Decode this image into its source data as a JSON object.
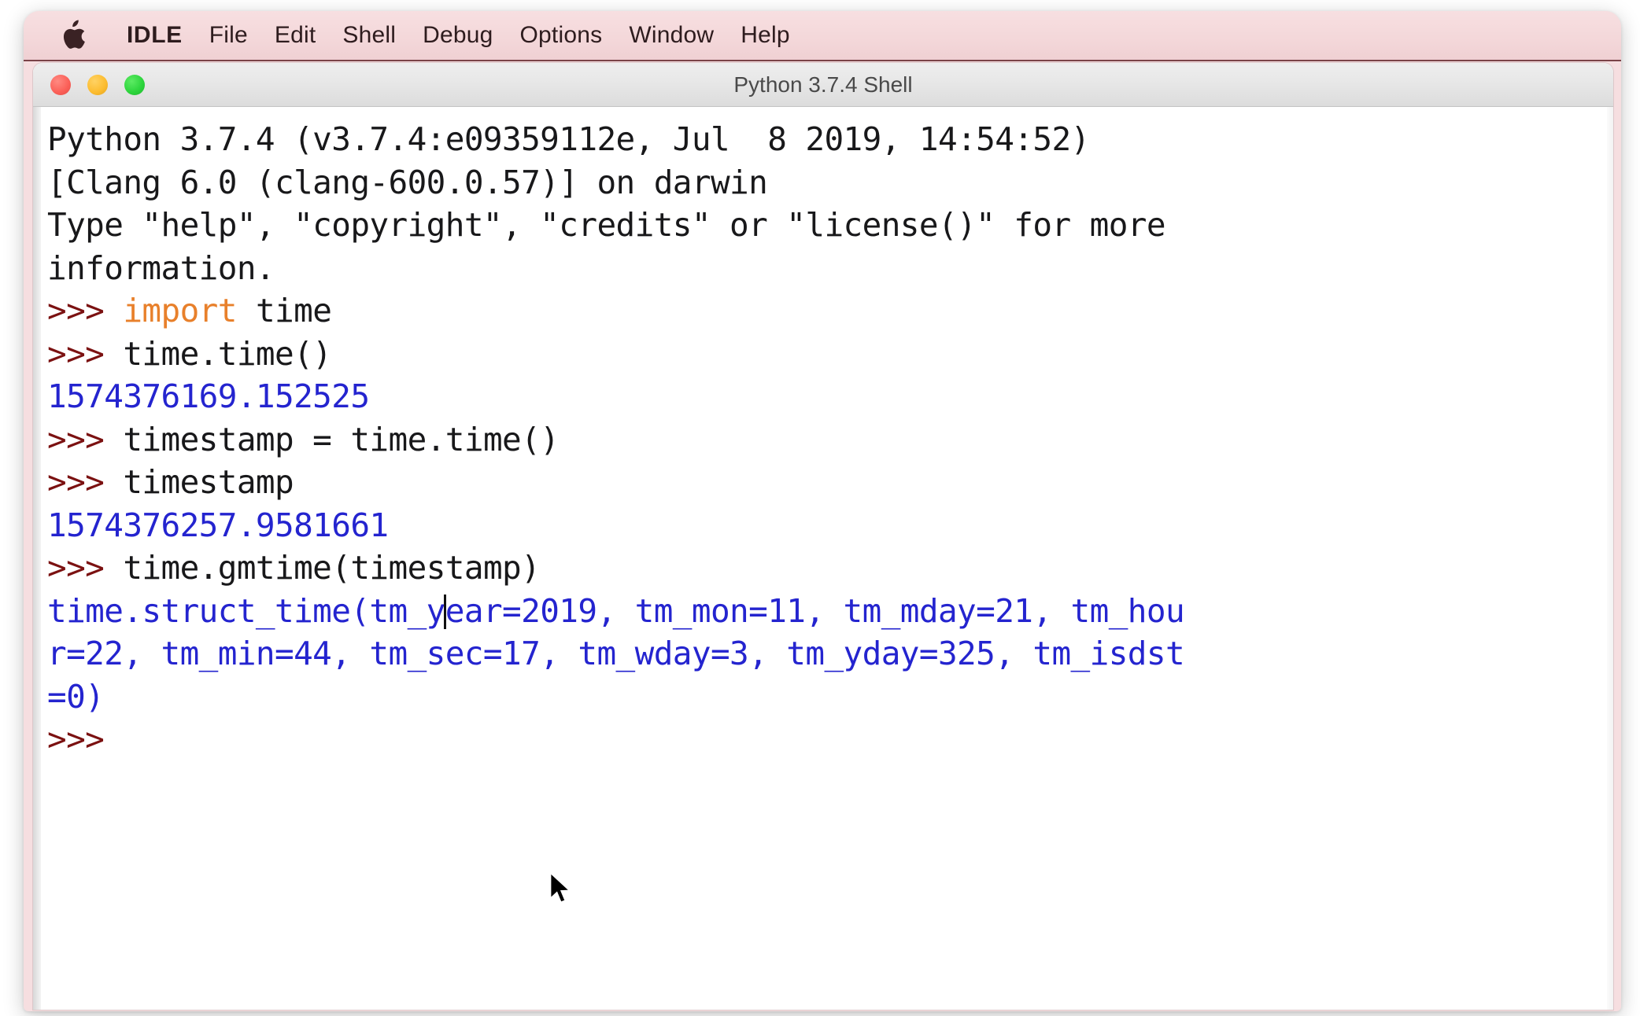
{
  "menubar": {
    "apple_icon": "apple-logo-icon",
    "items": [
      {
        "label": "IDLE",
        "bold": true
      },
      {
        "label": "File",
        "bold": false
      },
      {
        "label": "Edit",
        "bold": false
      },
      {
        "label": "Shell",
        "bold": false
      },
      {
        "label": "Debug",
        "bold": false
      },
      {
        "label": "Options",
        "bold": false
      },
      {
        "label": "Window",
        "bold": false
      },
      {
        "label": "Help",
        "bold": false
      }
    ],
    "background_color": "#f4d8da",
    "text_color": "#2e1c1e"
  },
  "window": {
    "title": "Python 3.7.4 Shell",
    "traffic_lights": [
      {
        "name": "close",
        "color": "#fb6058"
      },
      {
        "name": "minimize",
        "color": "#fcbc2f"
      },
      {
        "name": "zoom",
        "color": "#2cd43c"
      }
    ]
  },
  "colors": {
    "prompt": "#7b1111",
    "keyword": "#e8802b",
    "output": "#2424cf",
    "stdout": "#18181a",
    "background": "#ffffff"
  },
  "shell": {
    "lines": [
      {
        "segments": [
          {
            "text": "Python 3.7.4 (v3.7.4:e09359112e, Jul  8 2019, 14:54:52)",
            "style": "plain"
          }
        ]
      },
      {
        "segments": [
          {
            "text": "[Clang 6.0 (clang-600.0.57)] on darwin",
            "style": "plain"
          }
        ]
      },
      {
        "segments": [
          {
            "text": "Type \"help\", \"copyright\", \"credits\" or \"license()\" for more",
            "style": "plain"
          }
        ]
      },
      {
        "segments": [
          {
            "text": "information.",
            "style": "plain"
          }
        ]
      },
      {
        "segments": [
          {
            "text": ">>> ",
            "style": "prompt"
          },
          {
            "text": "import",
            "style": "keyword"
          },
          {
            "text": " time",
            "style": "plain"
          }
        ]
      },
      {
        "segments": [
          {
            "text": ">>> ",
            "style": "prompt"
          },
          {
            "text": "time.time()",
            "style": "plain"
          }
        ]
      },
      {
        "segments": [
          {
            "text": "1574376169.152525",
            "style": "output"
          }
        ]
      },
      {
        "segments": [
          {
            "text": ">>> ",
            "style": "prompt"
          },
          {
            "text": "timestamp = time.time()",
            "style": "plain"
          }
        ]
      },
      {
        "segments": [
          {
            "text": ">>> ",
            "style": "prompt"
          },
          {
            "text": "timestamp",
            "style": "plain"
          }
        ]
      },
      {
        "segments": [
          {
            "text": "1574376257.9581661",
            "style": "output"
          }
        ]
      },
      {
        "segments": [
          {
            "text": ">>> ",
            "style": "prompt"
          },
          {
            "text": "time.gmtime(timestamp)",
            "style": "plain"
          }
        ]
      },
      {
        "segments": [
          {
            "text": "time.struct_time(tm_y",
            "style": "output"
          },
          {
            "text": "",
            "style": "caret"
          },
          {
            "text": "ear=2019, tm_mon=11, tm_mday=21, tm_hou",
            "style": "output"
          }
        ]
      },
      {
        "segments": [
          {
            "text": "r=22, tm_min=44, tm_sec=17, tm_wday=3, tm_yday=325, tm_isdst",
            "style": "output"
          }
        ]
      },
      {
        "segments": [
          {
            "text": "=0)",
            "style": "output"
          }
        ]
      },
      {
        "segments": [
          {
            "text": ">>>",
            "style": "prompt"
          }
        ]
      }
    ]
  },
  "cursor": {
    "pointer_name": "mouse-arrow-pointer",
    "text_caret_name": "text-insertion-caret"
  }
}
